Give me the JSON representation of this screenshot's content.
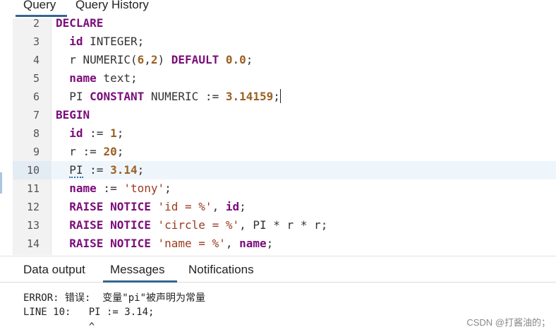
{
  "tabs": [
    {
      "label": "Query",
      "active": true
    },
    {
      "label": "Query History",
      "active": false
    }
  ],
  "editor": {
    "lines": [
      {
        "num": "2",
        "tokens": [
          {
            "t": "kw",
            "v": "DECLARE"
          }
        ]
      },
      {
        "num": "3",
        "tokens": [
          {
            "t": "p",
            "v": "  "
          },
          {
            "t": "kw",
            "v": "id"
          },
          {
            "t": "p",
            "v": " INTEGER;"
          }
        ]
      },
      {
        "num": "4",
        "tokens": [
          {
            "t": "p",
            "v": "  r NUMERIC("
          },
          {
            "t": "num",
            "v": "6"
          },
          {
            "t": "p",
            "v": ","
          },
          {
            "t": "num",
            "v": "2"
          },
          {
            "t": "p",
            "v": ") "
          },
          {
            "t": "kw",
            "v": "DEFAULT"
          },
          {
            "t": "p",
            "v": " "
          },
          {
            "t": "num",
            "v": "0.0"
          },
          {
            "t": "p",
            "v": ";"
          }
        ]
      },
      {
        "num": "5",
        "tokens": [
          {
            "t": "p",
            "v": "  "
          },
          {
            "t": "kw",
            "v": "name"
          },
          {
            "t": "p",
            "v": " text;"
          }
        ]
      },
      {
        "num": "6",
        "tokens": [
          {
            "t": "p",
            "v": "  PI "
          },
          {
            "t": "kw",
            "v": "CONSTANT"
          },
          {
            "t": "p",
            "v": " NUMERIC := "
          },
          {
            "t": "num",
            "v": "3.14159"
          },
          {
            "t": "p",
            "v": ";"
          },
          {
            "t": "cursor",
            "v": ""
          }
        ]
      },
      {
        "num": "7",
        "tokens": [
          {
            "t": "kw",
            "v": "BEGIN"
          }
        ]
      },
      {
        "num": "8",
        "tokens": [
          {
            "t": "p",
            "v": "  "
          },
          {
            "t": "kw",
            "v": "id"
          },
          {
            "t": "p",
            "v": " := "
          },
          {
            "t": "num",
            "v": "1"
          },
          {
            "t": "p",
            "v": ";"
          }
        ]
      },
      {
        "num": "9",
        "tokens": [
          {
            "t": "p",
            "v": "  r := "
          },
          {
            "t": "num",
            "v": "20"
          },
          {
            "t": "p",
            "v": ";"
          }
        ]
      },
      {
        "num": "10",
        "active": true,
        "tokens": [
          {
            "t": "p",
            "v": "  "
          },
          {
            "t": "sq",
            "v": "PI"
          },
          {
            "t": "p",
            "v": " := "
          },
          {
            "t": "num",
            "v": "3.14"
          },
          {
            "t": "p",
            "v": ";"
          }
        ]
      },
      {
        "num": "11",
        "tokens": [
          {
            "t": "p",
            "v": "  "
          },
          {
            "t": "kw",
            "v": "name"
          },
          {
            "t": "p",
            "v": " := "
          },
          {
            "t": "str",
            "v": "'tony'"
          },
          {
            "t": "p",
            "v": ";"
          }
        ]
      },
      {
        "num": "12",
        "tokens": [
          {
            "t": "p",
            "v": "  "
          },
          {
            "t": "kw",
            "v": "RAISE NOTICE"
          },
          {
            "t": "p",
            "v": " "
          },
          {
            "t": "str",
            "v": "'id = %'"
          },
          {
            "t": "p",
            "v": ", "
          },
          {
            "t": "kw",
            "v": "id"
          },
          {
            "t": "p",
            "v": ";"
          }
        ]
      },
      {
        "num": "13",
        "tokens": [
          {
            "t": "p",
            "v": "  "
          },
          {
            "t": "kw",
            "v": "RAISE NOTICE"
          },
          {
            "t": "p",
            "v": " "
          },
          {
            "t": "str",
            "v": "'circle = %'"
          },
          {
            "t": "p",
            "v": ", PI * r * r;"
          }
        ]
      },
      {
        "num": "14",
        "tokens": [
          {
            "t": "p",
            "v": "  "
          },
          {
            "t": "kw",
            "v": "RAISE NOTICE"
          },
          {
            "t": "p",
            "v": " "
          },
          {
            "t": "str",
            "v": "'name = %'"
          },
          {
            "t": "p",
            "v": ", "
          },
          {
            "t": "kw",
            "v": "name"
          },
          {
            "t": "p",
            "v": ";"
          }
        ]
      }
    ]
  },
  "results": {
    "tabs": [
      {
        "label": "Data output",
        "active": false
      },
      {
        "label": "Messages",
        "active": true
      },
      {
        "label": "Notifications",
        "active": false
      }
    ],
    "messages": [
      "ERROR: 错误:  变量\"pi\"被声明为常量",
      "LINE 10:   PI := 3.14;",
      "           ^"
    ]
  },
  "watermark": "CSDN @打酱油的；",
  "colors": {
    "accent": "#326690",
    "keyword": "#7a0c7a",
    "number": "#9b5f22",
    "string": "#9a3b1f",
    "active_line": "#eef6fc",
    "gutter": "#f2f2f2"
  }
}
